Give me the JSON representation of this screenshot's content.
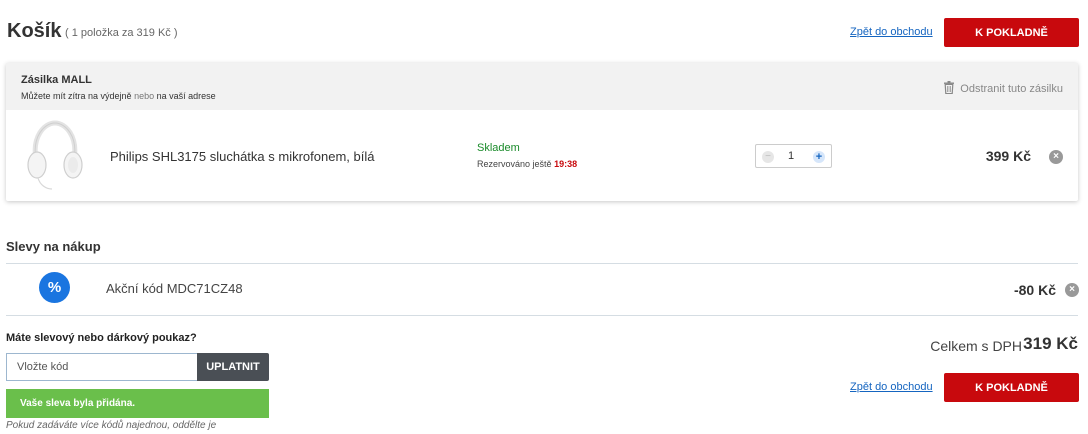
{
  "header": {
    "title": "Košík",
    "summary": "( 1 položka za 319 Kč )",
    "back_link": "Zpět do obchodu",
    "checkout_button": "K POKLADNĚ"
  },
  "shipment": {
    "title": "Zásilka MALL",
    "subtitle_part1": "Můžete mít zítra na výdejně",
    "subtitle_or": "nebo",
    "subtitle_part2": "na vaší adrese",
    "remove_label": "Odstranit tuto zásilku",
    "item": {
      "name": "Philips SHL3175 sluchátka s mikrofonem, bílá",
      "stock_status": "Skladem",
      "reserved_label": "Rezervováno ještě",
      "reserved_time": "19:38",
      "quantity": "1",
      "price": "399 Kč"
    }
  },
  "discounts": {
    "title": "Slevy na nákup",
    "items": [
      {
        "icon_text": "%",
        "label": "Akční kód MDC71CZ48",
        "value": "-80 Kč"
      }
    ]
  },
  "voucher": {
    "question": "Máte slevový nebo dárkový poukaz?",
    "placeholder": "Vložte kód",
    "apply_button": "UPLATNIT",
    "success_message": "Vaše sleva byla přidána.",
    "hint": "Pokud zadáváte více kódů najednou, oddělte je"
  },
  "totals": {
    "label": "Celkem s DPH",
    "value": "319 Kč",
    "back_link": "Zpět do obchodu",
    "checkout_button": "K POKLADNĚ"
  },
  "colors": {
    "primary_red": "#c8090d",
    "link_blue": "#1565c0",
    "success_green": "#6abf4b",
    "discount_blue": "#1a75e0",
    "stock_green": "#1a8b2a"
  }
}
